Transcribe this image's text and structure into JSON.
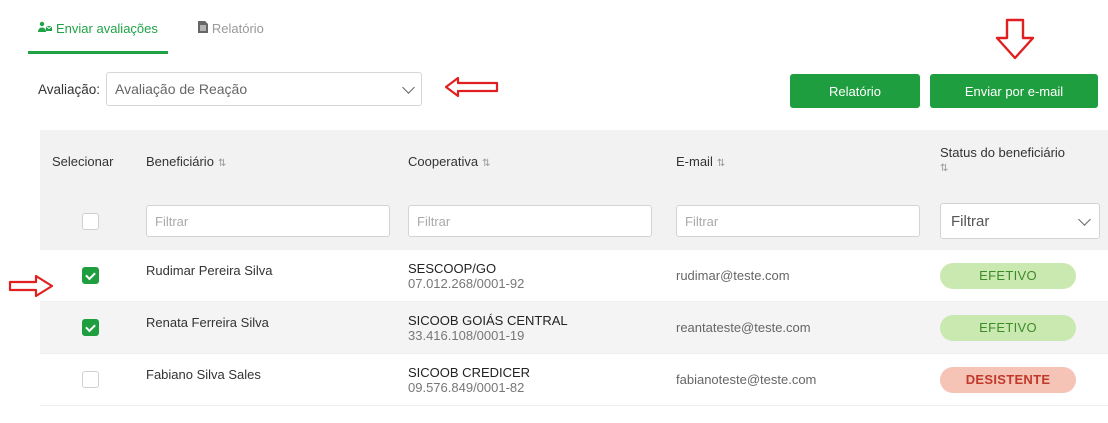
{
  "tabs": [
    {
      "label": "Enviar avaliações",
      "icon": "users-send-icon",
      "active": true
    },
    {
      "label": "Relatório",
      "icon": "document-icon",
      "active": false
    }
  ],
  "evaluation": {
    "label": "Avaliação:",
    "selected": "Avaliação de Reação"
  },
  "buttons": {
    "report": "Relatório",
    "send_email": "Enviar por e-mail"
  },
  "table": {
    "headers": {
      "select": "Selecionar",
      "beneficiary": "Beneficiário",
      "cooperative": "Cooperativa",
      "email": "E-mail",
      "status": "Status do beneficiário"
    },
    "filters": {
      "beneficiary": "Filtrar",
      "cooperative": "Filtrar",
      "email": "Filtrar",
      "status": "Filtrar"
    },
    "rows": [
      {
        "checked": true,
        "name": "Rudimar Pereira Silva",
        "coop": "SESCOOP/GO",
        "cnpj": "07.012.268/0001-92",
        "email": "rudimar@teste.com",
        "status": "EFETIVO"
      },
      {
        "checked": true,
        "name": "Renata Ferreira Silva",
        "coop": "SICOOB GOIÁS CENTRAL",
        "cnpj": "33.416.108/0001-19",
        "email": "reantateste@teste.com",
        "status": "EFETIVO"
      },
      {
        "checked": false,
        "name": "Fabiano Silva Sales",
        "coop": "SICOOB CREDICER",
        "cnpj": "09.576.849/0001-82",
        "email": "fabianoteste@teste.com",
        "status": "DESISTENTE"
      }
    ]
  },
  "colors": {
    "accent": "#1e9e3e",
    "annotation": "#e02020",
    "efetivo_bg": "#c9e9b0",
    "desistente_bg": "#f5c4b6"
  }
}
